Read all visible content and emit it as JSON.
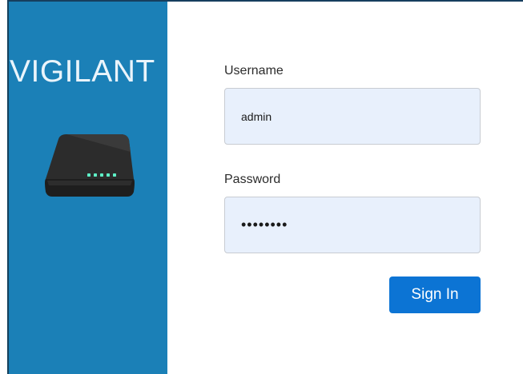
{
  "brand": {
    "name": "VIGILANT",
    "icon": "router-icon",
    "panel_color": "#1b80b7",
    "led_color": "#5ef0c6"
  },
  "login": {
    "username_label": "Username",
    "username_value": "admin",
    "password_label": "Password",
    "password_value": "password",
    "signin_label": "Sign In"
  },
  "colors": {
    "input_bg": "#e8f0fc",
    "button_bg": "#0c74d4"
  }
}
